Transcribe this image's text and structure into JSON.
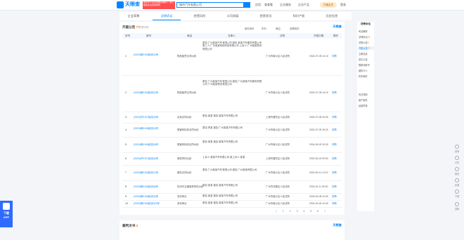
{
  "header": {
    "logo_text": "天眼查",
    "promo_text": "国家中小企业发展基金旗下 官方备案企业征信机构",
    "search_value": "城市汽车有限公司",
    "nav": [
      "应用",
      "查查看",
      "企业服务",
      "企业产品",
      "开通会员",
      "登录"
    ]
  },
  "tabs": [
    {
      "label": "企业背景",
      "active": false
    },
    {
      "label": "法律诉讼",
      "active": true
    },
    {
      "label": "经营风险",
      "active": false
    },
    {
      "label": "公司发展",
      "active": false
    },
    {
      "label": "经营状况",
      "active": false
    },
    {
      "label": "知识产权",
      "active": false
    },
    {
      "label": "历史信息",
      "active": false
    }
  ],
  "panel": {
    "title": "开庭公告",
    "count": "77",
    "subtitle": "查看详情",
    "brand": "天眼查",
    "filters": [
      "案件身份",
      "年份",
      "案由",
      "查看相关"
    ],
    "columns": [
      "序号",
      "案号",
      "案由",
      "当事人",
      "法院",
      "开庭日期",
      "操作"
    ],
    "rows": [
      {
        "no": "1",
        "case": "(2024)粤0106民初(1)号",
        "cause": "物品租赁合同纠纷",
        "party": "原告:广州某某汽车有限公司 被告:某某汽车服务有限公司 第三人:广东某某网络科技有限公司 上诉人:广州某某物流有限公司",
        "court": "广州市南沙区人民法院",
        "date": "2024-07-08 14:10",
        "op": "详情"
      },
      {
        "no": "2",
        "case": "(2024)粤0106民初(2)号",
        "cause": "物品租赁合同纠纷",
        "party": "原告:广州某某汽车有限公司 被告:广州某某汽车服务有限公司 广州某某物流有限公司",
        "court": "广州市南沙区人民法院",
        "date": "2024-07-08 14:10",
        "op": "详情"
      },
      {
        "no": "3",
        "case": "(2024)沪0107民初(3)号",
        "cause": "买卖合同纠纷",
        "party": "原告:某某 被告:某某汽车有限公司",
        "court": "上海市普陀区人民法院",
        "date": "2024-07-08 15:30",
        "op": "详情"
      },
      {
        "no": "4",
        "case": "(2024)粤0106民初(4)号",
        "cause": "侵害商标权合同纠纷",
        "party": "原告:李某 被告:广州某某汽车有限公司",
        "court": "广州市南沙区人民法院",
        "date": "2024-07-05 15:20",
        "op": "详情"
      },
      {
        "no": "5",
        "case": "(2024)粤0106民初(5)号",
        "cause": "侵害商标权合同纠纷",
        "party": "原告:某某 被告:某某汽车有限公司",
        "court": "广州市南沙区人民法院",
        "date": "2024-06-26 10:00",
        "op": "详情"
      },
      {
        "no": "6",
        "case": "(2024)沪0107民初(6)号",
        "cause": "侵权责任纠纷",
        "party": "上诉人:某某汽车有限公司 被上诉人:某某",
        "court": "上海市普陀区人民法院",
        "date": "2024-06-24 09:00",
        "op": "详情"
      },
      {
        "no": "7",
        "case": "(2024)粤0106民初(7)号",
        "cause": "服务合同纠纷",
        "party": "原告:广州某某汽车有限公司 被告:广州某某有限公司",
        "court": "广州市南沙区人民法院",
        "date": "2024-06-11 14:10",
        "op": "详情"
      },
      {
        "no": "8",
        "case": "(2024)粤0106民初(8)号",
        "cause": "机动车交通事故责任纠纷",
        "party": "原告:某某 被告:某某汽车有限公司",
        "court": "广州市花都区人民法院",
        "date": "2024-04-11 09:30",
        "op": "详情"
      },
      {
        "no": "9",
        "case": "(2024)粤0106民初(9)号",
        "cause": "劳动争议",
        "party": "原告:某某 被告:某某汽车有限公司",
        "court": "广州市南沙区人民法院",
        "date": "2024-04-08 14:30",
        "op": "详情"
      },
      {
        "no": "10",
        "case": "(2024)粤0106民初(10)号",
        "cause": "劳动争议",
        "party": "原告:某某 被告:某某汽车有限公司",
        "court": "广州市南沙区人民法院",
        "date": "2024-03-26 14:30",
        "op": "详情"
      }
    ],
    "pager": [
      "<",
      "1",
      "2",
      "3",
      "4",
      "5",
      "6",
      ">"
    ]
  },
  "panel2": {
    "title": "裁判文书",
    "count": "2",
    "brand": "天眼查"
  },
  "sidebar": {
    "title": "法律诉讼",
    "items": [
      {
        "label": "司法解析",
        "n": ""
      },
      {
        "label": "法律诉讼",
        "n": "13"
      },
      {
        "label": "法院公告",
        "n": "3"
      },
      {
        "label": "开庭公告",
        "n": "77"
      },
      {
        "label": "立案信息",
        "n": ""
      },
      {
        "label": "送达公告",
        "n": ""
      },
      {
        "label": "限制消费令",
        "n": ""
      },
      {
        "label": "被执行人",
        "n": ""
      },
      {
        "label": "终本案件",
        "n": ""
      },
      {
        "label": "司法协助",
        "n": ""
      },
      {
        "label": "破产案件",
        "n": ""
      },
      {
        "label": "经营异常",
        "n": ""
      }
    ]
  },
  "right_tools": [
    "咨询",
    "分享",
    "投诉",
    "纠错",
    "下载",
    "顶部"
  ],
  "app_badge": {
    "line1": "下载",
    "line2": "APP"
  }
}
